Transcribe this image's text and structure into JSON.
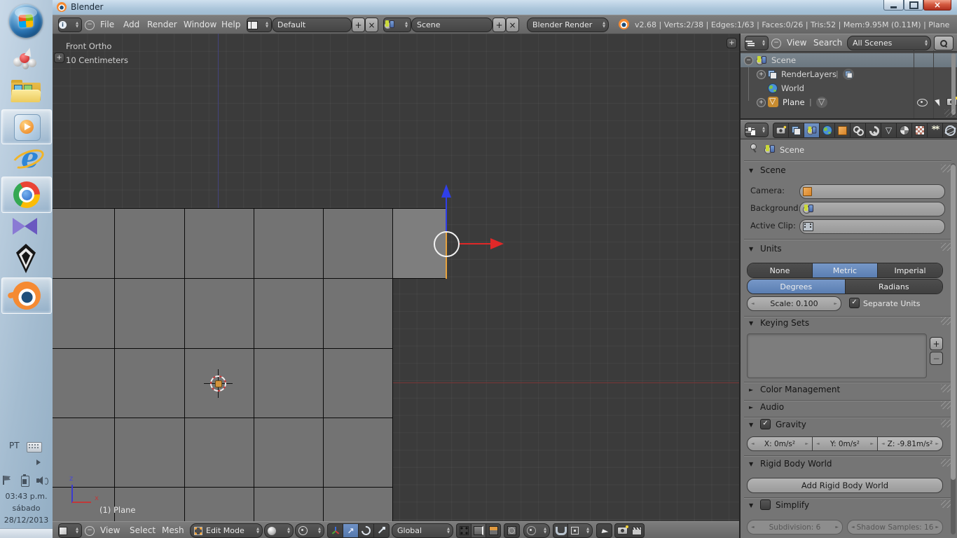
{
  "window": {
    "title": "Blender"
  },
  "taskbar": {
    "language": "PT",
    "time": "03:43 p.m.",
    "weekday": "sábado",
    "date": "28/12/2013",
    "app_icons": [
      "start-orb",
      "molecule-app",
      "windows-explorer",
      "windows-media-player",
      "internet-explorer",
      "google-chrome",
      "kmplayer",
      "skyrim",
      "blender"
    ]
  },
  "icons": {
    "panel_open": "▼",
    "panel_closed": "►",
    "check": "✓",
    "plus": "+",
    "minus": "−",
    "close": "×"
  },
  "info_header": {
    "menus": [
      "File",
      "Add",
      "Render",
      "Window",
      "Help"
    ],
    "layout_name": "Default",
    "scene_name": "Scene",
    "engine": "Blender Render",
    "stats": "v2.68 | Verts:2/38 | Edges:1/63 | Faces:0/26 | Tris:52 | Mem:9.95M (0.11M) | Plane"
  },
  "viewport": {
    "view_label": "Front Ortho",
    "grid_scale_label": "10 Centimeters",
    "active_object_label": "(1) Plane",
    "axis_labels": {
      "x": "x",
      "z": "z"
    }
  },
  "viewport_header": {
    "menus": [
      "View",
      "Select",
      "Mesh"
    ],
    "mode": "Edit Mode",
    "orientation": "Global"
  },
  "outliner": {
    "header_menus": [
      "View",
      "Search"
    ],
    "scenes_filter": "All Scenes",
    "separator": "|",
    "rows": [
      {
        "label": "Scene"
      },
      {
        "label": "RenderLayers"
      },
      {
        "label": "World"
      },
      {
        "label": "Plane"
      }
    ]
  },
  "properties": {
    "context_label": "Scene",
    "panels": {
      "scene": {
        "title": "Scene",
        "rows": [
          {
            "label": "Camera:"
          },
          {
            "label": "Background:"
          },
          {
            "label": "Active Clip:"
          }
        ]
      },
      "units": {
        "title": "Units",
        "system": [
          "None",
          "Metric",
          "Imperial"
        ],
        "system_active": "Metric",
        "rotation": [
          "Degrees",
          "Radians"
        ],
        "rotation_active": "Degrees",
        "scale": "Scale: 0.100",
        "separate_units": "Separate Units"
      },
      "keying_sets": {
        "title": "Keying Sets"
      },
      "color_management": {
        "title": "Color Management"
      },
      "audio": {
        "title": "Audio"
      },
      "gravity": {
        "title": "Gravity",
        "enabled": true,
        "fields": [
          "X: 0m/s²",
          "Y: 0m/s²",
          "Z: -9.81m/s²"
        ]
      },
      "rigid_body_world": {
        "title": "Rigid Body World",
        "add_button": "Add Rigid Body World"
      },
      "simplify": {
        "title": "Simplify",
        "enabled": false,
        "fields": [
          "Subdivision: 6",
          "Shadow Samples: 16"
        ]
      }
    }
  },
  "colors": {
    "accent_blue": "#5a7eb2",
    "selected_edge_orange": "#e9a33c",
    "axis_x_red": "#7a3535",
    "axis_z_blue": "#44447c",
    "manipulator_red": "#e02828",
    "manipulator_blue": "#2f3fe8",
    "taskbar_blue": "#b9cfe2",
    "close_button_red": "#c84a32",
    "viewport_bg": "#3b3b3b",
    "mesh_face_gray": "#737373",
    "active_face_gray": "#7e7e7e"
  }
}
